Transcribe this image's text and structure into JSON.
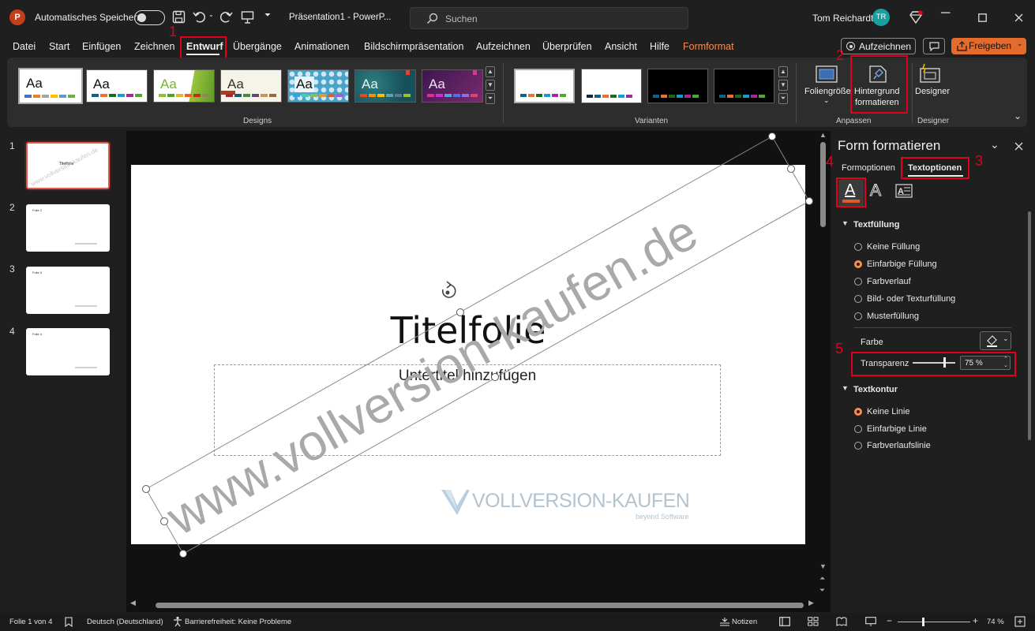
{
  "titlebar": {
    "app_icon": "P",
    "autosave_label": "Automatisches Speichern",
    "document_title": "Präsentation1  -  PowerP...",
    "search_placeholder": "Suchen",
    "user_name": "Tom Reichardt",
    "user_initials": "TR"
  },
  "menu": {
    "items": [
      "Datei",
      "Start",
      "Einfügen",
      "Zeichnen",
      "Entwurf",
      "Übergänge",
      "Animationen",
      "Bildschirmpräsentation",
      "Aufzeichnen",
      "Überprüfen",
      "Ansicht",
      "Hilfe",
      "Formformat"
    ],
    "active": "Entwurf",
    "record_button": "Aufzeichnen",
    "share_button": "Freigeben"
  },
  "annotations": [
    "1",
    "2",
    "3",
    "4",
    "5"
  ],
  "ribbon": {
    "designs_label": "Designs",
    "variants_label": "Varianten",
    "customize_label": "Anpassen",
    "designer_group_label": "Designer",
    "design_thumb_text": "Aa",
    "slide_size": "Foliengröße",
    "format_background_line1": "Hintergrund",
    "format_background_line2": "formatieren",
    "designer_button": "Designer"
  },
  "slides_pane": {
    "numbers": [
      "1",
      "2",
      "3",
      "4"
    ],
    "thumb_titles": [
      "Titelfolie",
      "Folie 2",
      "Folie 3",
      "Folie 4"
    ]
  },
  "slide": {
    "title": "Titelfolie",
    "subtitle": "Untertitel hinzufügen",
    "watermark": "www.vollversion-kaufen.de",
    "logo_text": "VOLLVERSION-KAUFEN",
    "logo_tagline": "beyond Software"
  },
  "format_pane": {
    "title": "Form formatieren",
    "tab_shape": "Formoptionen",
    "tab_text": "Textoptionen",
    "section_fill": "Textfüllung",
    "fill_options": [
      "Keine Füllung",
      "Einfarbige Füllung",
      "Farbverlauf",
      "Bild- oder Texturfüllung",
      "Musterfüllung"
    ],
    "fill_selected_index": 1,
    "color_label": "Farbe",
    "transparency_label": "Transparenz",
    "transparency_value": "75 %",
    "transparency_level": 0.75,
    "section_outline": "Textkontur",
    "outline_options": [
      "Keine Linie",
      "Einfarbige Linie",
      "Farbverlaufslinie"
    ],
    "outline_selected_index": 0
  },
  "statusbar": {
    "slide_info": "Folie 1 von 4",
    "language": "Deutsch (Deutschland)",
    "accessibility": "Barrierefreiheit: Keine Probleme",
    "notes": "Notizen",
    "zoom": "74 %"
  },
  "colors": {
    "accent_orange": "#ff8a4d",
    "annotation_red": "#e3001b",
    "share_button": "#e46b2c",
    "avatar": "#19a0a0"
  }
}
